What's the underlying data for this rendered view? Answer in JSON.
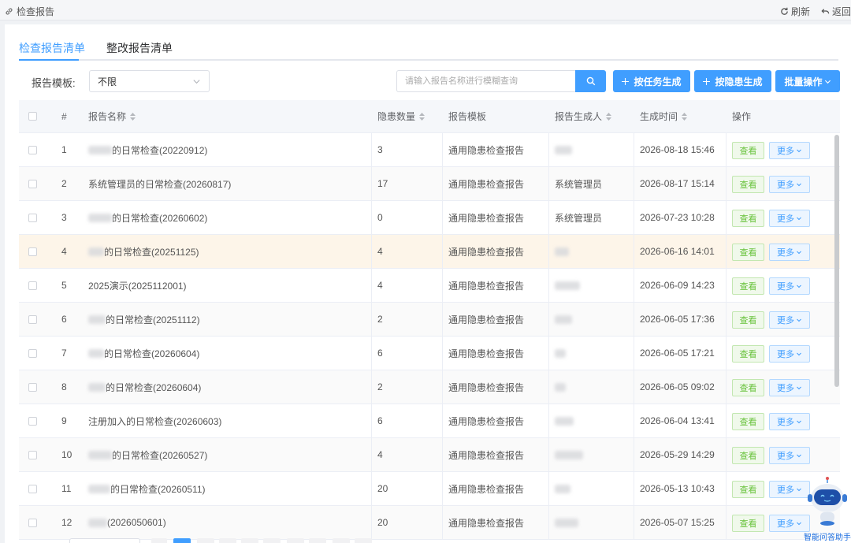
{
  "topbar": {
    "breadcrumb": "检查报告",
    "refresh_label": "刷新",
    "back_label": "返回"
  },
  "tabs": [
    {
      "label": "检查报告清单",
      "active": true
    },
    {
      "label": "整改报告清单",
      "active": false
    }
  ],
  "filter": {
    "template_label": "报告模板:",
    "template_value": "不限",
    "search_placeholder": "请输入报告名称进行模糊查询"
  },
  "buttons": {
    "by_task": "按任务生成",
    "by_hazard": "按隐患生成",
    "batch": "批量操作"
  },
  "table": {
    "headers": {
      "index": "#",
      "name": "报告名称",
      "count": "隐患数量",
      "template": "报告模板",
      "creator": "报告生成人",
      "time": "生成时间",
      "actions": "操作"
    },
    "view_label": "查看",
    "more_label": "更多",
    "rows": [
      {
        "index": "1",
        "name": "的日常检查(20220912)",
        "count": "3",
        "template": "通用隐患检查报告",
        "creator": "",
        "time": "2026-08-18 15:46"
      },
      {
        "index": "2",
        "name": "系统管理员的日常检查(20260817)",
        "count": "17",
        "template": "通用隐患检查报告",
        "creator": "系统管理员",
        "time": "2026-08-17 15:14"
      },
      {
        "index": "3",
        "name": "的日常检查(20260602)",
        "count": "0",
        "template": "通用隐患检查报告",
        "creator": "系统管理员",
        "time": "2026-07-23 10:28"
      },
      {
        "index": "4",
        "name": "的日常检查(20251125)",
        "count": "4",
        "template": "通用隐患检查报告",
        "creator": "",
        "time": "2026-06-16 14:01"
      },
      {
        "index": "5",
        "name": "2025演示(2025112001)",
        "count": "4",
        "template": "通用隐患检查报告",
        "creator": "",
        "time": "2026-06-09 14:23"
      },
      {
        "index": "6",
        "name": "的日常检查(20251112)",
        "count": "2",
        "template": "通用隐患检查报告",
        "creator": "",
        "time": "2026-06-05 17:36"
      },
      {
        "index": "7",
        "name": "的日常检查(20260604)",
        "count": "6",
        "template": "通用隐患检查报告",
        "creator": "",
        "time": "2026-06-05 17:21"
      },
      {
        "index": "8",
        "name": "的日常检查(20260604)",
        "count": "2",
        "template": "通用隐患检查报告",
        "creator": "",
        "time": "2026-06-05 09:02"
      },
      {
        "index": "9",
        "name": "注册加入的日常检查(20260603)",
        "count": "6",
        "template": "通用隐患检查报告",
        "creator": "",
        "time": "2026-06-04 13:41"
      },
      {
        "index": "10",
        "name": "的日常检查(20260527)",
        "count": "4",
        "template": "通用隐患检查报告",
        "creator": "",
        "time": "2026-05-29 14:29"
      },
      {
        "index": "11",
        "name": "的日常检查(20260511)",
        "count": "20",
        "template": "通用隐患检查报告",
        "creator": "",
        "time": "2026-05-13 10:43"
      },
      {
        "index": "12",
        "name": "(2026050601)",
        "count": "20",
        "template": "通用隐患检查报告",
        "creator": "",
        "time": "2026-05-07 15:25"
      }
    ]
  },
  "assistant": {
    "label": "智能问答助手"
  },
  "colors": {
    "primary": "#409eff",
    "success": "#67c23a",
    "row_highlight": "#fdf5e9"
  }
}
